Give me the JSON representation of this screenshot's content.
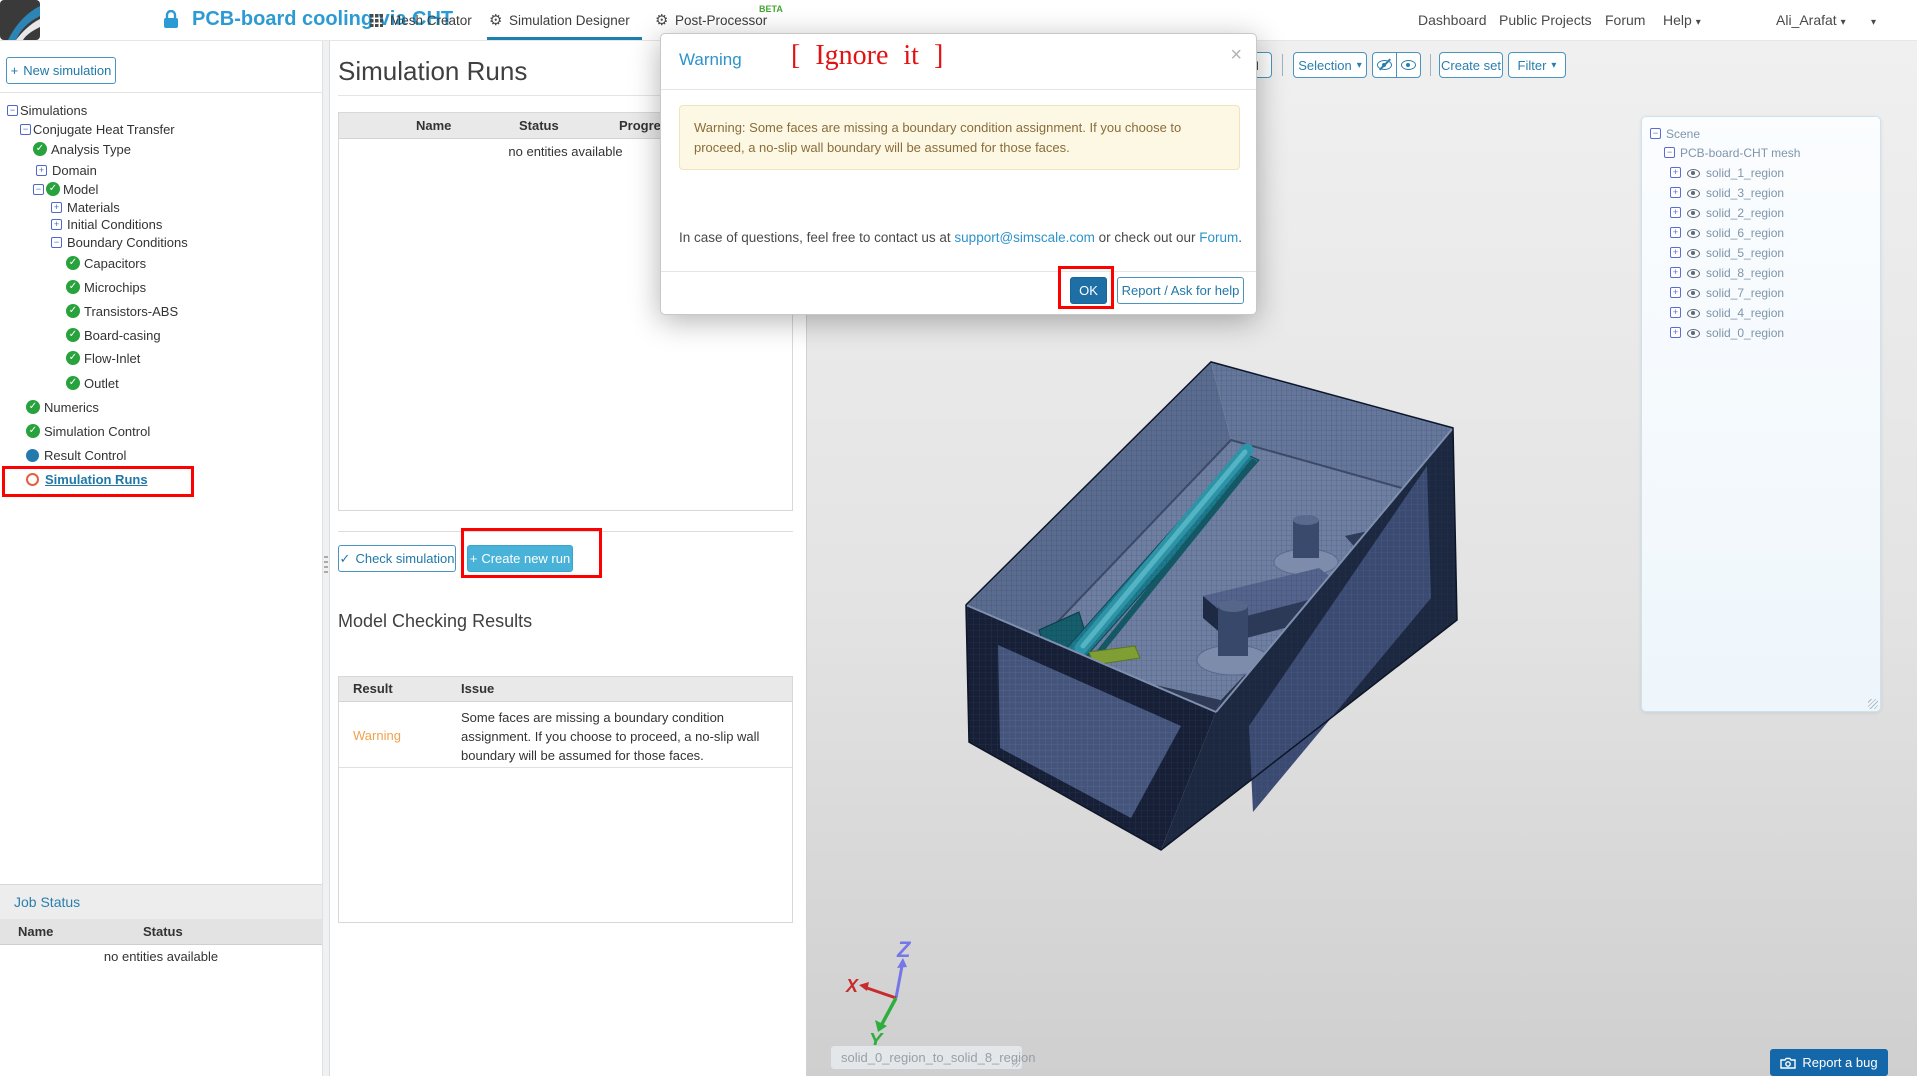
{
  "icons": {
    "plus": "+",
    "minus": "−",
    "check": "✓",
    "close": "×",
    "caret_down": "▾",
    "gear": "⚙"
  },
  "colors": {
    "accent_blue": "#2d93c9",
    "button_blue": "#1f78a8",
    "create_run_bg": "#49b2d8",
    "ok_bg": "#1d6fa5",
    "warning_text": "#f0a24e",
    "alert_bg": "#fcf8e3",
    "alert_text": "#8a6d3b",
    "annotation_red": "#ff0000",
    "check_green": "#28a23c",
    "beta_green": "#44a832"
  },
  "navbar": {
    "project_title": "PCB-board cooling via CHT",
    "tabs": [
      {
        "label": "Mesh Creator"
      },
      {
        "label": "Simulation Designer"
      },
      {
        "label": "Post-Processor",
        "badge": "BETA"
      }
    ],
    "links": {
      "dashboard": "Dashboard",
      "public_projects": "Public Projects",
      "forum": "Forum",
      "help": "Help",
      "user": "Ali_Arafat"
    }
  },
  "sidebar": {
    "new_simulation_label": "New simulation",
    "tree": [
      {
        "label": "Simulations"
      },
      {
        "label": "Conjugate Heat Transfer"
      },
      {
        "label": "Analysis Type"
      },
      {
        "label": "Domain"
      },
      {
        "label": "Model"
      },
      {
        "label": "Materials"
      },
      {
        "label": "Initial Conditions"
      },
      {
        "label": "Boundary Conditions"
      },
      {
        "label": "Capacitors"
      },
      {
        "label": "Microchips"
      },
      {
        "label": "Transistors-ABS"
      },
      {
        "label": "Board-casing"
      },
      {
        "label": "Flow-Inlet"
      },
      {
        "label": "Outlet"
      },
      {
        "label": "Numerics"
      },
      {
        "label": "Simulation Control"
      },
      {
        "label": "Result Control"
      },
      {
        "label": "Simulation Runs"
      }
    ],
    "job_status": {
      "title": "Job Status",
      "columns": [
        "Name",
        "Status"
      ],
      "empty_text": "no entities available"
    }
  },
  "runs_panel": {
    "title": "Simulation Runs",
    "columns": [
      "Name",
      "Status",
      "Progress"
    ],
    "empty_text": "no entities available",
    "check_button": "Check simulation",
    "create_button": "Create new run",
    "model_checking": {
      "title": "Model Checking Results",
      "columns": [
        "Result",
        "Issue"
      ],
      "rows": [
        {
          "result": "Warning",
          "issue": "Some faces are missing a boundary condition assignment. If you choose to proceed, a no-slip wall boundary will be assumed for those faces."
        }
      ]
    }
  },
  "modal": {
    "title": "Warning",
    "alert_text": "Warning: Some faces are missing a boundary condition assignment. If you choose to proceed, a no-slip wall boundary will be assumed for those faces.",
    "contact": {
      "prefix": "In case of questions, feel free to contact us at ",
      "email": "support@simscale.com",
      "middle": " or check out our ",
      "link": "Forum",
      "suffix": "."
    },
    "ok_button": "OK",
    "report_button": "Report / Ask for help"
  },
  "annotations": {
    "ignore_text": "[ Ignore it ]"
  },
  "viewer": {
    "toolbar": {
      "selection": "Selection",
      "create_set": "Create set",
      "filter": "Filter"
    },
    "scene_tree": {
      "root": "Scene",
      "mesh_name": "PCB-board-CHT mesh",
      "regions": [
        "solid_1_region",
        "solid_3_region",
        "solid_2_region",
        "solid_6_region",
        "solid_5_region",
        "solid_8_region",
        "solid_7_region",
        "solid_4_region",
        "solid_0_region"
      ]
    },
    "axes": {
      "x": "X",
      "y": "Y",
      "z": "Z"
    },
    "tooltip": "solid_0_region_to_solid_8_region",
    "report_bug_label": "Report a bug"
  }
}
